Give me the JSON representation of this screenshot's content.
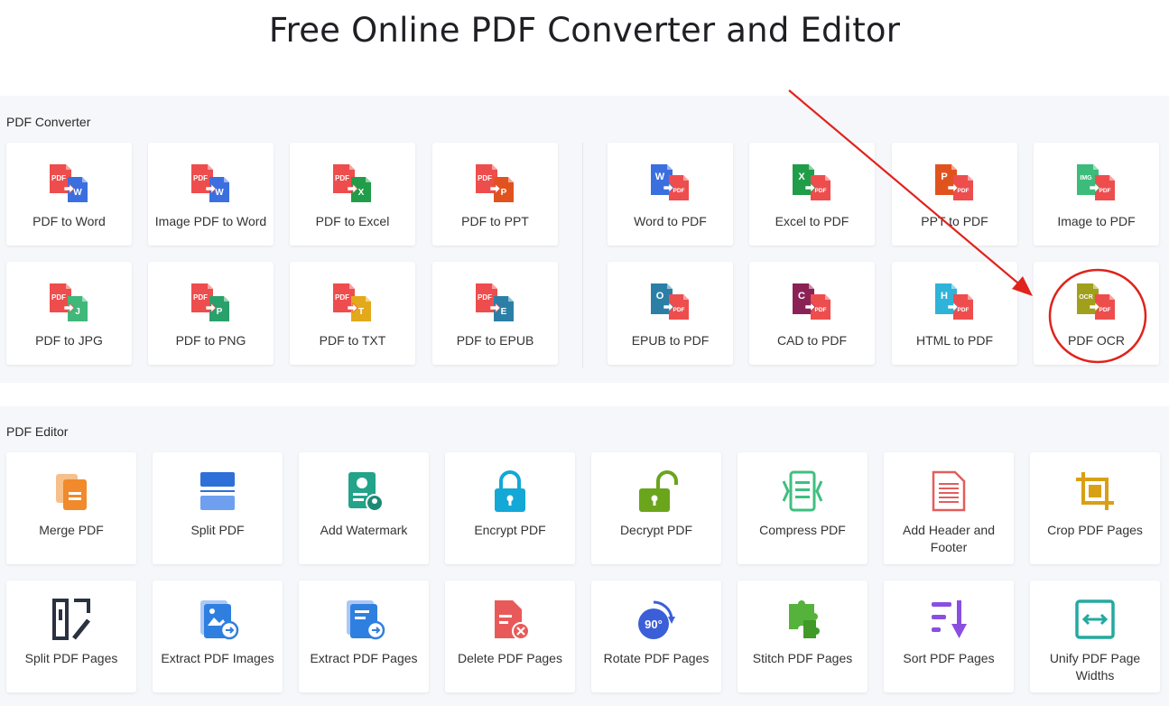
{
  "page": {
    "title": "Free Online PDF Converter and Editor"
  },
  "converter": {
    "heading": "PDF Converter",
    "items": [
      {
        "label": "PDF to Word",
        "icon": "pdf-to-word-icon",
        "badge": "W",
        "color": "#3b6fe0"
      },
      {
        "label": "Image PDF to Word",
        "icon": "image-pdf-to-word-icon",
        "badge": "W",
        "color": "#3b6fe0"
      },
      {
        "label": "PDF to Excel",
        "icon": "pdf-to-excel-icon",
        "badge": "X",
        "color": "#1f9d48"
      },
      {
        "label": "PDF to PPT",
        "icon": "pdf-to-ppt-icon",
        "badge": "P",
        "color": "#e0531f"
      },
      {
        "label": "Word to PDF",
        "icon": "word-to-pdf-icon",
        "badge": "W",
        "color": "#3b6fe0"
      },
      {
        "label": "Excel to PDF",
        "icon": "excel-to-pdf-icon",
        "badge": "X",
        "color": "#1f9d48"
      },
      {
        "label": "PPT to PDF",
        "icon": "ppt-to-pdf-icon",
        "badge": "P",
        "color": "#e0531f"
      },
      {
        "label": "Image to PDF",
        "icon": "image-to-pdf-icon",
        "badge": "IMG",
        "color": "#3dbb7a"
      },
      {
        "label": "PDF to JPG",
        "icon": "pdf-to-jpg-icon",
        "badge": "J",
        "color": "#3fb87a"
      },
      {
        "label": "PDF to PNG",
        "icon": "pdf-to-png-icon",
        "badge": "P",
        "color": "#2aa06b"
      },
      {
        "label": "PDF to TXT",
        "icon": "pdf-to-txt-icon",
        "badge": "T",
        "color": "#e3a91a"
      },
      {
        "label": "PDF to EPUB",
        "icon": "pdf-to-epub-icon",
        "badge": "E",
        "color": "#2b7fa6"
      },
      {
        "label": "EPUB to PDF",
        "icon": "epub-to-pdf-icon",
        "badge": "O",
        "color": "#2b7fa6"
      },
      {
        "label": "CAD to PDF",
        "icon": "cad-to-pdf-icon",
        "badge": "C",
        "color": "#8a2256"
      },
      {
        "label": "HTML to PDF",
        "icon": "html-to-pdf-icon",
        "badge": "H",
        "color": "#2fb3d8"
      },
      {
        "label": "PDF OCR",
        "icon": "pdf-ocr-icon",
        "badge": "OCR",
        "color": "#a0a01c"
      }
    ],
    "pdf_tag": "PDF"
  },
  "editor": {
    "heading": "PDF Editor",
    "items": [
      {
        "label": "Merge PDF",
        "icon": "merge-pdf-icon",
        "color": "#f08a2c"
      },
      {
        "label": "Split PDF",
        "icon": "split-pdf-icon",
        "color": "#2f6fd8"
      },
      {
        "label": "Add Watermark",
        "icon": "add-watermark-icon",
        "color": "#22a38a"
      },
      {
        "label": "Encrypt PDF",
        "icon": "encrypt-pdf-icon",
        "color": "#13a8d6"
      },
      {
        "label": "Decrypt PDF",
        "icon": "decrypt-pdf-icon",
        "color": "#6aa51c"
      },
      {
        "label": "Compress PDF",
        "icon": "compress-pdf-icon",
        "color": "#3fbf7f"
      },
      {
        "label": "Add Header and Footer",
        "icon": "add-header-footer-icon",
        "color": "#e35d5d"
      },
      {
        "label": "Crop PDF Pages",
        "icon": "crop-pdf-pages-icon",
        "color": "#d9a015"
      },
      {
        "label": "Split PDF Pages",
        "icon": "split-pdf-pages-icon",
        "color": "#2a3140"
      },
      {
        "label": "Extract PDF Images",
        "icon": "extract-pdf-images-icon",
        "color": "#2f7fe0"
      },
      {
        "label": "Extract PDF Pages",
        "icon": "extract-pdf-pages-icon",
        "color": "#2f7fe0"
      },
      {
        "label": "Delete PDF Pages",
        "icon": "delete-pdf-pages-icon",
        "color": "#e85a5a"
      },
      {
        "label": "Rotate PDF Pages",
        "icon": "rotate-pdf-pages-icon",
        "color": "#3b5fd8",
        "text": "90°"
      },
      {
        "label": "Stitch PDF Pages",
        "icon": "stitch-pdf-pages-icon",
        "color": "#55b33c"
      },
      {
        "label": "Sort PDF Pages",
        "icon": "sort-pdf-pages-icon",
        "color": "#8a4fe0"
      },
      {
        "label": "Unify PDF Page Widths",
        "icon": "unify-pdf-page-widths-icon",
        "color": "#23a9a0"
      }
    ]
  },
  "annotation": {
    "color": "#e0231c"
  }
}
